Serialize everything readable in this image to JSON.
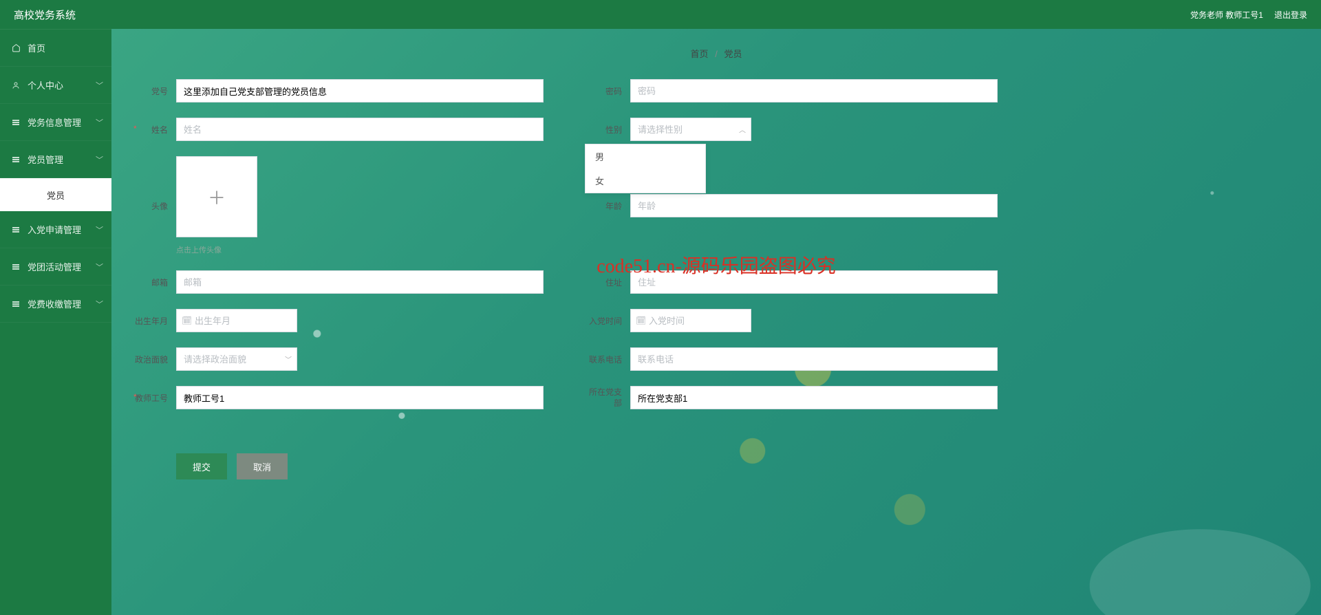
{
  "header": {
    "title": "高校党务系统",
    "user": "党务老师 教师工号1",
    "logout": "退出登录"
  },
  "sidebar": {
    "items": [
      {
        "label": "首页",
        "icon": "home"
      },
      {
        "label": "个人中心",
        "icon": "user",
        "expandable": true
      },
      {
        "label": "党务信息管理",
        "icon": "list",
        "expandable": true
      },
      {
        "label": "党员管理",
        "icon": "list",
        "expandable": true,
        "active": true
      },
      {
        "label": "入党申请管理",
        "icon": "list",
        "expandable": true
      },
      {
        "label": "党团活动管理",
        "icon": "list",
        "expandable": true
      },
      {
        "label": "党费收缴管理",
        "icon": "list",
        "expandable": true
      }
    ],
    "sub_item": "党员"
  },
  "breadcrumb": {
    "home": "首页",
    "sep": "/",
    "current": "党员"
  },
  "watermark": "code51.cn-源码乐园盗图必究",
  "form": {
    "danghao": {
      "label": "党号",
      "value": "这里添加自己党支部管理的党员信息"
    },
    "mima": {
      "label": "密码",
      "placeholder": "密码"
    },
    "xingming": {
      "label": "姓名",
      "placeholder": "姓名"
    },
    "xingbie": {
      "label": "性别",
      "placeholder": "请选择性别",
      "options": [
        "男",
        "女"
      ]
    },
    "touxiang": {
      "label": "头像",
      "hint": "点击上传头像"
    },
    "nianling": {
      "label": "年龄",
      "placeholder": "年龄"
    },
    "youxiang": {
      "label": "邮箱",
      "placeholder": "邮箱"
    },
    "zhuzhi": {
      "label": "住址",
      "placeholder": "住址"
    },
    "chusheng": {
      "label": "出生年月",
      "placeholder": "出生年月"
    },
    "rudang": {
      "label": "入党时间",
      "placeholder": "入党时间"
    },
    "zhengzhi": {
      "label": "政治面貌",
      "placeholder": "请选择政治面貌"
    },
    "lianxi": {
      "label": "联系电话",
      "placeholder": "联系电话"
    },
    "jiaoshi": {
      "label": "教师工号",
      "value": "教师工号1"
    },
    "zhibu_a": "所在党支",
    "zhibu_b": "部",
    "zhibu": {
      "value": "所在党支部1"
    }
  },
  "buttons": {
    "submit": "提交",
    "cancel": "取消"
  }
}
